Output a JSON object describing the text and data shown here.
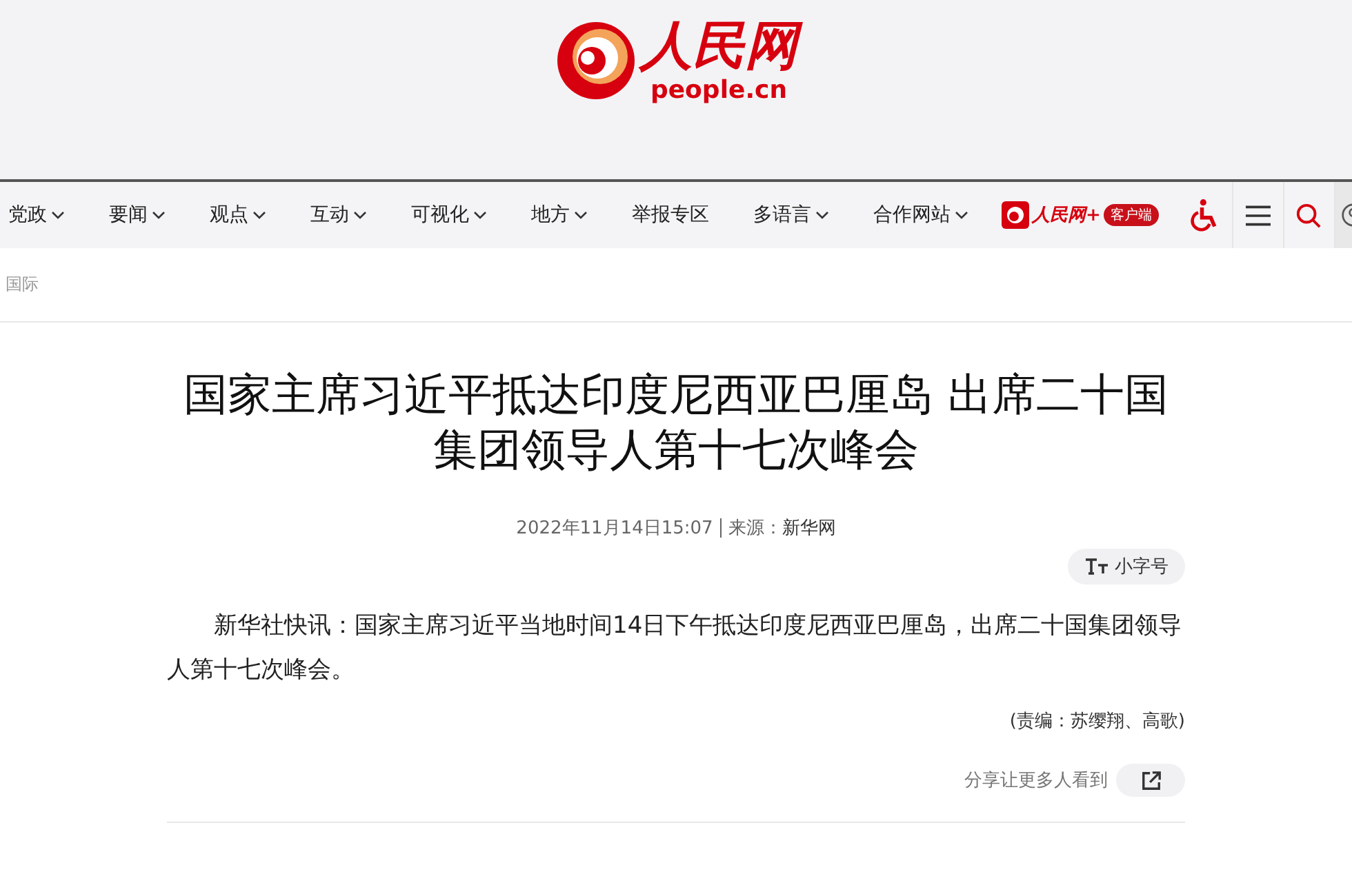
{
  "header": {
    "logo_text": "人民网",
    "logo_domain": "people.cn"
  },
  "nav": {
    "items": [
      {
        "label": "党政",
        "dropdown": true
      },
      {
        "label": "要闻",
        "dropdown": true
      },
      {
        "label": "观点",
        "dropdown": true
      },
      {
        "label": "互动",
        "dropdown": true
      },
      {
        "label": "可视化",
        "dropdown": true
      },
      {
        "label": "地方",
        "dropdown": true
      },
      {
        "label": "举报专区",
        "dropdown": false
      },
      {
        "label": "多语言",
        "dropdown": true
      },
      {
        "label": "合作网站",
        "dropdown": true
      }
    ],
    "app": {
      "name": "人民网+",
      "badge": "客户端"
    }
  },
  "breadcrumb": "国际",
  "article": {
    "title": "国家主席习近平抵达印度尼西亚巴厘岛 出席二十国集团领导人第十七次峰会",
    "date": "2022年11月14日15:07",
    "source_label": "来源：",
    "source": "新华网",
    "font_button": "小字号",
    "paragraph": "新华社快讯：国家主席习近平当地时间14日下午抵达印度尼西亚巴厘岛，出席二十国集团领导人第十七次峰会。",
    "editor": "(责编：苏缨翔、高歌)",
    "share_label": "分享让更多人看到"
  }
}
